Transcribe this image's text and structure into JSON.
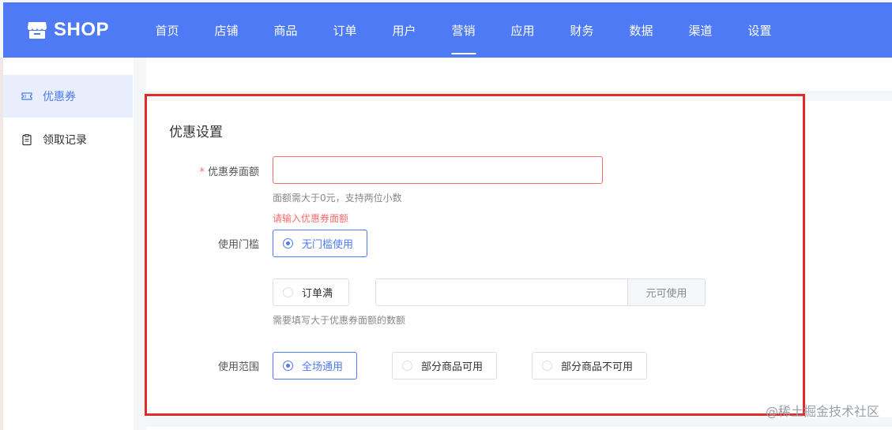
{
  "header": {
    "brand": "SHOP",
    "nav": [
      "首页",
      "店铺",
      "商品",
      "订单",
      "用户",
      "营销",
      "应用",
      "财务",
      "数据",
      "渠道",
      "设置"
    ],
    "active_nav": "营销",
    "accent_color": "#4e7bf5"
  },
  "sidebar": {
    "items": [
      {
        "label": "优惠券",
        "icon": "ticket-icon",
        "active": true
      },
      {
        "label": "领取记录",
        "icon": "clipboard-icon",
        "active": false
      }
    ]
  },
  "form": {
    "title": "优惠设置",
    "amount": {
      "required_mark": "*",
      "label": "优惠券面额",
      "value": "",
      "hint": "面额需大于0元，支持两位小数",
      "error": "请输入优惠券面额",
      "error_color": "#f56c6c"
    },
    "threshold": {
      "label": "使用门槛",
      "options": [
        "无门槛使用",
        "订单满"
      ],
      "selected": "无门槛使用",
      "amount_value": "",
      "suffix": "元可使用",
      "hint": "需要填写大于优惠券面额的数额"
    },
    "scope": {
      "label": "使用范围",
      "options": [
        "全场通用",
        "部分商品可用",
        "部分商品不可用"
      ],
      "selected": "全场通用"
    }
  },
  "watermark": "@稀土掘金技术社区"
}
